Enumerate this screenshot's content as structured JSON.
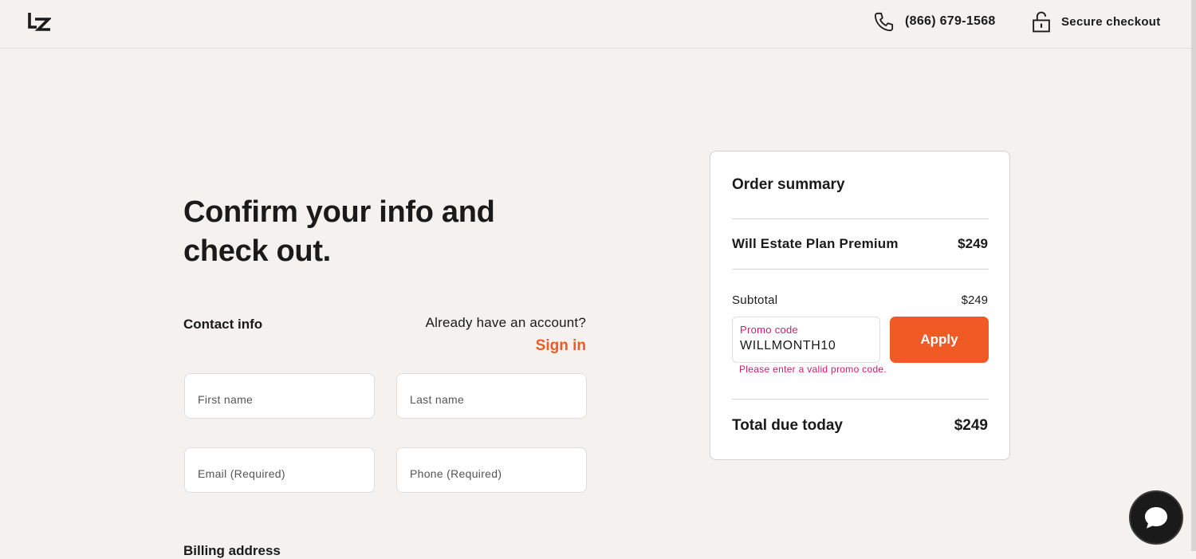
{
  "header": {
    "logo": "lz-logo",
    "phone": "(866) 679-1568",
    "secure_checkout": "Secure checkout",
    "icons": {
      "phone": "phone-icon",
      "lock": "lock-icon"
    }
  },
  "main": {
    "heading": "Confirm your info and check out.",
    "contact_label": "Contact info",
    "account_question": "Already have an account?",
    "sign_in": "Sign in",
    "fields": {
      "first_name_placeholder": "First name",
      "last_name_placeholder": "Last name",
      "email_placeholder": "Email (Required)",
      "phone_placeholder": "Phone (Required)"
    },
    "billing_label": "Billing address"
  },
  "summary": {
    "title": "Order summary",
    "item_name": "Will Estate Plan Premium",
    "item_price": "$249",
    "subtotal_label": "Subtotal",
    "subtotal_value": "$249",
    "promo_label": "Promo code",
    "promo_value": "WILLMONTH10",
    "apply_label": "Apply",
    "promo_error": "Please enter a valid promo code.",
    "total_label": "Total due today",
    "total_value": "$249"
  },
  "chat": {
    "icon": "chat-bubble-icon"
  },
  "colors": {
    "accent": "#f05a24",
    "error": "#d6196c",
    "background": "#f4f1ee"
  }
}
